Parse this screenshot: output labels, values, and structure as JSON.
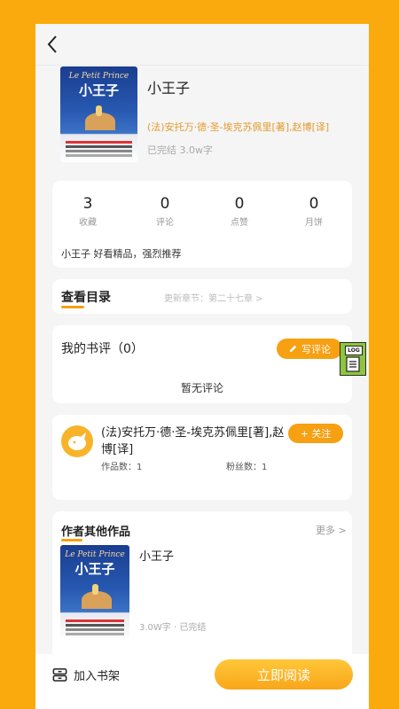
{
  "book": {
    "cover_series": "Le Petit Prince",
    "cover_title": "小王子",
    "title": "小王子",
    "author": "(法)安托万·德·圣-埃克苏佩里[著],赵博[译]",
    "status": "已完结 3.0w字"
  },
  "stats": [
    {
      "value": "3",
      "label": "收藏"
    },
    {
      "value": "0",
      "label": "评论"
    },
    {
      "value": "0",
      "label": "点赞"
    },
    {
      "value": "0",
      "label": "月饼"
    }
  ],
  "blurb": "小王子 好看精品，强烈推荐",
  "catalog": {
    "title": "查看目录",
    "update_text": "更新章节：第二十七章 >"
  },
  "reviews": {
    "title": "我的书评（0）",
    "write_label": "写评论",
    "empty_text": "暂无评论"
  },
  "author_card": {
    "name": "(法)安托万·德·圣-埃克苏佩里[著],赵博[译]",
    "follow_label": "+ 关注",
    "works_count": "作品数：1",
    "fans_count": "粉丝数：1"
  },
  "other_works": {
    "title": "作者其他作品",
    "more_label": "更多 >",
    "items": [
      {
        "title": "小王子",
        "meta": "3.0W字 · 已完结",
        "cover_series": "Le Petit Prince",
        "cover_title": "小王子"
      }
    ]
  },
  "bottom": {
    "shelf_label": "加入书架",
    "read_label": "立即阅读"
  },
  "floating": {
    "log_label": "LOG"
  },
  "colors": {
    "background": "#FAAA0C",
    "accent": "#F6A012",
    "author_text": "#E49A2C"
  }
}
